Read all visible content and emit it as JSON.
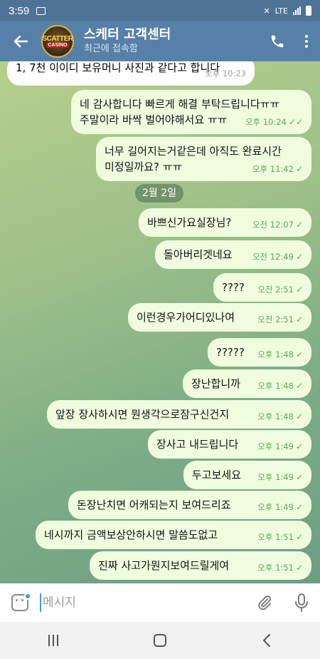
{
  "status_bar": {
    "time": "3:59",
    "network": "LTE"
  },
  "header": {
    "title": "스케터 고객센터",
    "subtitle": "최근에 접속함",
    "avatar_text_top": "SCATTER",
    "avatar_text_bottom": "CASINO"
  },
  "messages": [
    {
      "direction": "in",
      "text": "1, 7천 이이디 보유머니 사진과 같다고 합니다",
      "time": "오후 10:23",
      "read": false
    },
    {
      "direction": "out",
      "text": "네 감사합니다 빠르게 해결 부탁드립니다ㅠㅠ",
      "text2": "주말이라 바싹 벌어야해서요 ㅠㅠ",
      "time": "오후 10:24",
      "read": true
    },
    {
      "direction": "out",
      "text": "너무 길어지는거같은데 아직도 완료시간",
      "text2": "미정일까요? ㅠㅠ",
      "time": "오후 11:42",
      "read": false
    },
    {
      "direction": "out",
      "text": "바쁘신가요실장님?",
      "time": "오전 12:07",
      "read": false
    },
    {
      "direction": "out",
      "text": "돌아버리겟네요",
      "time": "오전 12:49",
      "read": false
    },
    {
      "direction": "out",
      "text": "????",
      "time": "오전 2:51",
      "read": false
    },
    {
      "direction": "out",
      "text": "이런경우가어디있나여",
      "time": "오전 2:51",
      "read": false
    },
    {
      "direction": "out",
      "text": "?????",
      "time": "오후 1:48",
      "read": false
    },
    {
      "direction": "out",
      "text": "장난합니까",
      "time": "오후 1:48",
      "read": false
    },
    {
      "direction": "out",
      "text": "앞장 장사하시면 뭔생각으로잠구신건지",
      "time": "오후 1:48",
      "read": false
    },
    {
      "direction": "out",
      "text": "장사고 내드립니다",
      "time": "오후 1:49",
      "read": false
    },
    {
      "direction": "out",
      "text": "두고보세요",
      "time": "오후 1:49",
      "read": false
    },
    {
      "direction": "out",
      "text": "돈장난치면 어캐되는지 보여드리죠",
      "time": "오후 1:49",
      "read": false
    },
    {
      "direction": "out",
      "text": "네시까지  금액보상안하시면 말씀도없고",
      "time": "오후 1:51",
      "read": false
    },
    {
      "direction": "out",
      "text": "진짜 사고가뭔지보여드릴게여",
      "time": "오후 1:51",
      "read": false
    }
  ],
  "date_divider": "2월 2일",
  "input": {
    "placeholder": "메시지"
  },
  "colors": {
    "header": "#5680a8",
    "outgoing_bubble": "#effdde",
    "check": "#5fa35e"
  }
}
